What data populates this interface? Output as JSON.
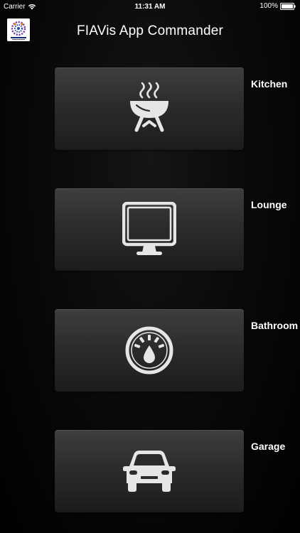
{
  "status_bar": {
    "carrier": "Carrier",
    "time": "11:31 AM",
    "battery": "100%"
  },
  "nav_bar": {
    "title": "FIAVis App Commander",
    "logo_icon": "fiavis-logo-icon"
  },
  "rooms": [
    {
      "label": "Kitchen",
      "icon": "grill-icon"
    },
    {
      "label": "Lounge",
      "icon": "monitor-icon"
    },
    {
      "label": "Bathroom",
      "icon": "gauge-icon"
    },
    {
      "label": "Garage",
      "icon": "car-icon"
    }
  ],
  "colors": {
    "background": "#000000",
    "button_top": "#3e3e3e",
    "button_bottom": "#1c1c1c",
    "icon": "#e6e6e6",
    "text": "#ffffff"
  }
}
